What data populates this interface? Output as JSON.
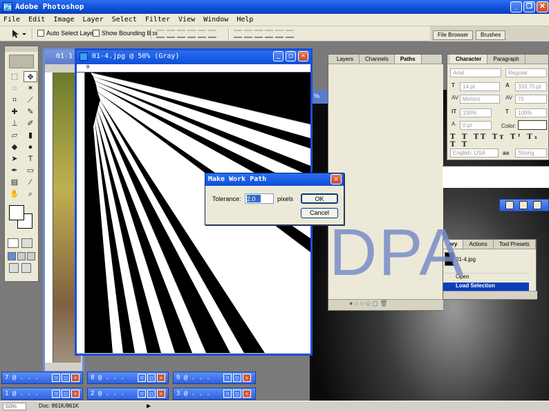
{
  "app": {
    "title": "Adobe Photoshop"
  },
  "menu": [
    "File",
    "Edit",
    "Image",
    "Layer",
    "Select",
    "Filter",
    "View",
    "Window",
    "Help"
  ],
  "options": {
    "auto_select_layer": "Auto Select Layer",
    "show_bounding_box": "Show Bounding Box",
    "well_tabs": [
      "File Browser",
      "Brushes"
    ]
  },
  "documents": {
    "main_title": "01-4.jpg @ 50% (Gray)",
    "back_title": "01-1",
    "ruler_zero": "0",
    "side_title_fragment": "%"
  },
  "layers_panel": {
    "tabs": [
      "Layers",
      "Channels",
      "Paths"
    ]
  },
  "character_panel": {
    "tabs": [
      "Character",
      "Paragraph"
    ],
    "font": "Arial",
    "style": "Regular",
    "size": "14 pt",
    "leading": "333.75 pt",
    "kerning": "Metrics",
    "tracking": "75",
    "vscale": "100%",
    "hscale": "100%",
    "baseline": "0 pt",
    "color_label": "Color:",
    "language": "English: USA",
    "antialias": "Strong",
    "aa_label": "aa"
  },
  "history_panel": {
    "tabs": [
      "ory",
      "Actions",
      "Tool Presets"
    ],
    "snapshot": "01-4.jpg",
    "items": [
      "Open",
      "Load Selection"
    ]
  },
  "dialog": {
    "title": "Make Work Path",
    "tolerance_label": "Tolerance:",
    "tolerance_value": "2.0",
    "unit": "pixels",
    "ok": "OK",
    "cancel": "Cancel"
  },
  "watermark": "DPA",
  "minimized": [
    "7 @ . . .",
    "8 @ . . .",
    "9 @ . . .",
    "1 @ . . .",
    "2 @ . . .",
    "3 @ . . ."
  ],
  "status": {
    "zoom": "50%",
    "doc": "Doc: 861K/861K"
  }
}
